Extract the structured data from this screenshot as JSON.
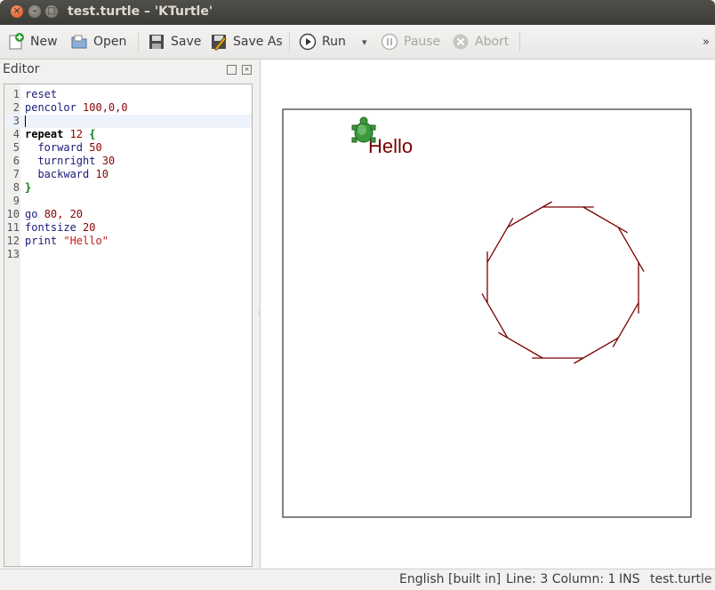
{
  "window": {
    "title": "test.turtle – 'KTurtle'",
    "buttons": {
      "close": "×",
      "minimize": "–",
      "maximize": "□"
    }
  },
  "toolbar": {
    "new_label": "New",
    "open_label": "Open",
    "save_label": "Save",
    "save_as_label": "Save As",
    "run_label": "Run",
    "pause_label": "Pause",
    "abort_label": "Abort",
    "overflow": "»",
    "dropdown_arrow": "▾"
  },
  "editor": {
    "title": "Editor",
    "lines": [
      {
        "num": "1",
        "tokens": [
          {
            "t": "reset",
            "c": "kw-cmd"
          }
        ]
      },
      {
        "num": "2",
        "tokens": [
          {
            "t": "pencolor ",
            "c": "kw-cmd"
          },
          {
            "t": "100,0,0",
            "c": "kw-num"
          }
        ]
      },
      {
        "num": "3",
        "tokens": []
      },
      {
        "num": "4",
        "tokens": [
          {
            "t": "repeat ",
            "c": "kw-ctl"
          },
          {
            "t": "12 ",
            "c": "kw-num"
          },
          {
            "t": "{",
            "c": "kw-brace"
          }
        ]
      },
      {
        "num": "5",
        "tokens": [
          {
            "t": "  forward ",
            "c": "kw-cmd"
          },
          {
            "t": "50",
            "c": "kw-num"
          }
        ]
      },
      {
        "num": "6",
        "tokens": [
          {
            "t": "  turnright ",
            "c": "kw-cmd"
          },
          {
            "t": "30",
            "c": "kw-num"
          }
        ]
      },
      {
        "num": "7",
        "tokens": [
          {
            "t": "  backward ",
            "c": "kw-cmd"
          },
          {
            "t": "10",
            "c": "kw-num"
          }
        ]
      },
      {
        "num": "8",
        "tokens": [
          {
            "t": "}",
            "c": "kw-brace"
          }
        ]
      },
      {
        "num": "9",
        "tokens": []
      },
      {
        "num": "10",
        "tokens": [
          {
            "t": "go ",
            "c": "kw-cmd"
          },
          {
            "t": "80, 20",
            "c": "kw-num"
          }
        ]
      },
      {
        "num": "11",
        "tokens": [
          {
            "t": "fontsize ",
            "c": "kw-cmd"
          },
          {
            "t": "20",
            "c": "kw-num"
          }
        ]
      },
      {
        "num": "12",
        "tokens": [
          {
            "t": "print ",
            "c": "kw-cmd"
          },
          {
            "t": "\"Hello\"",
            "c": "kw-str"
          }
        ]
      },
      {
        "num": "13",
        "tokens": []
      }
    ],
    "current_line": 3
  },
  "canvas": {
    "printed_text": "Hello",
    "pen_color": "#7a0000"
  },
  "status": {
    "language": "English [built in]",
    "position": "Line: 3 Column: 1",
    "mode": "INS",
    "filename": "test.turtle"
  }
}
